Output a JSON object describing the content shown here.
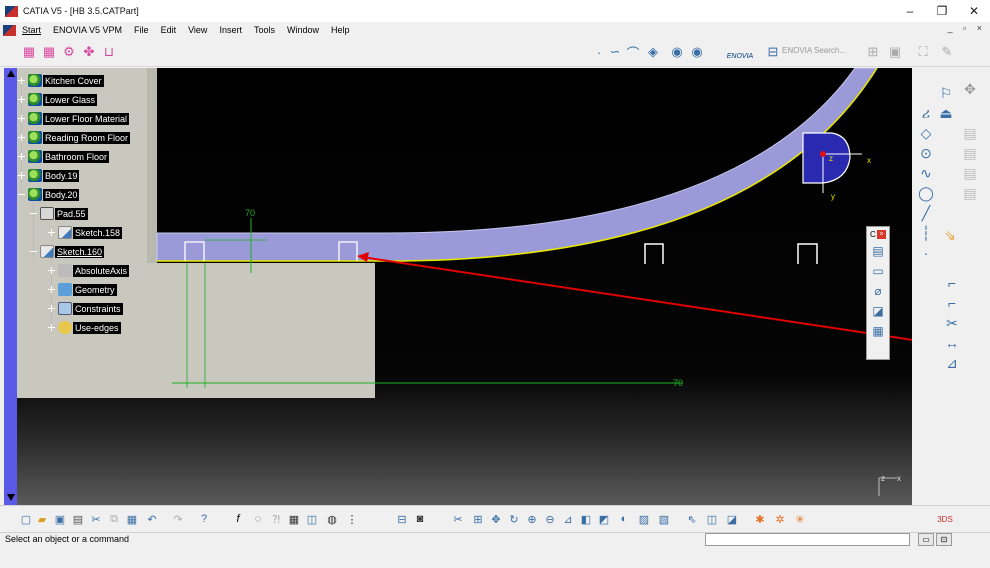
{
  "window": {
    "title": "CATIA V5 - [HB 3.5.CATPart]",
    "minimize": "–",
    "restore": "❐",
    "close": "✕"
  },
  "menu": {
    "items": [
      "Start",
      "ENOVIA V5 VPM",
      "File",
      "Edit",
      "View",
      "Insert",
      "Tools",
      "Window",
      "Help"
    ],
    "mdi_controls": "_ ▫ ×"
  },
  "toolbar": {
    "enovia_brand": "ENOVIA",
    "enovia_search": "ENOVIA Search..."
  },
  "tree": {
    "nodes": [
      {
        "label": "Kitchen Cover",
        "icon": "body-icon"
      },
      {
        "label": "Lower Glass",
        "icon": "body-icon"
      },
      {
        "label": "Lower Floor Material",
        "icon": "body-icon"
      },
      {
        "label": "Reading Room Floor",
        "icon": "body-icon"
      },
      {
        "label": "Bathroom Floor",
        "icon": "body-icon"
      },
      {
        "label": "Body.19",
        "icon": "body-icon"
      },
      {
        "label": "Body.20",
        "icon": "body-icon"
      },
      {
        "label": "Pad.55",
        "icon": "pad-icon"
      },
      {
        "label": "Sketch.158",
        "icon": "sketch-icon"
      },
      {
        "label": "Sketch.160",
        "icon": "sketch-icon"
      },
      {
        "label": "AbsoluteAxis",
        "icon": "axis-icon"
      },
      {
        "label": "Geometry",
        "icon": "geometry-icon"
      },
      {
        "label": "Constraints",
        "icon": "constraints-icon"
      },
      {
        "label": "Use-edges",
        "icon": "use-edges-icon"
      }
    ]
  },
  "viewport": {
    "dimension_vertical": "70",
    "dimension_horizontal": "70",
    "compass_labels": {
      "x": "x",
      "y": "y",
      "z": "z"
    },
    "axis_labels": {
      "z": "z",
      "x": "x"
    }
  },
  "floating_toolbar": {
    "title": "C"
  },
  "status": {
    "message": "Select an object or a command"
  },
  "colors": {
    "viewport_bg": "#000000",
    "arc_fill": "#9a9ad8",
    "sketch_line": "#e8e800",
    "dimension": "#20b020",
    "annotation_arrow": "#e00000",
    "left_scroll": "#5a5ae8"
  }
}
